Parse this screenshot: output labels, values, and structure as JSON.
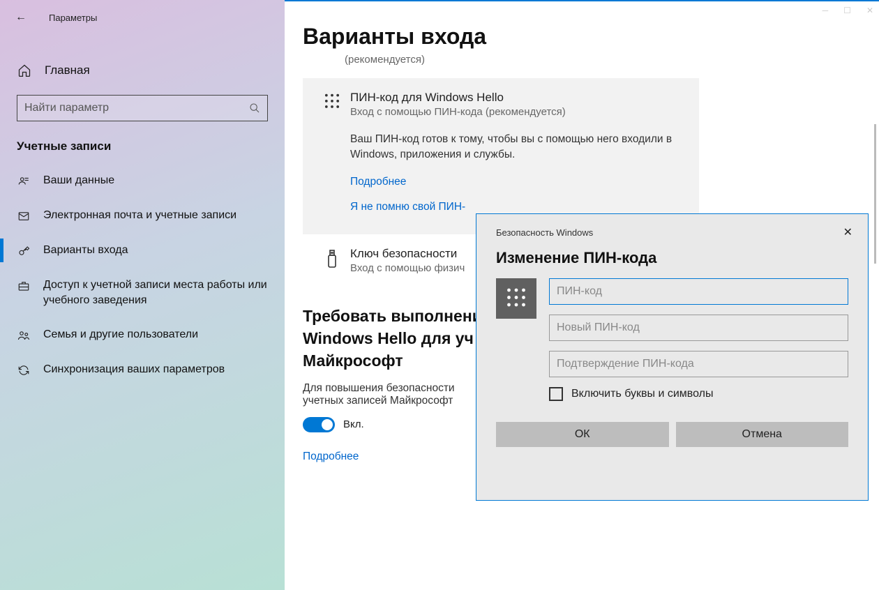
{
  "window": {
    "title": "Параметры"
  },
  "sidebar": {
    "home": "Главная",
    "search_placeholder": "Найти параметр",
    "section": "Учетные записи",
    "items": [
      "Ваши данные",
      "Электронная почта и учетные записи",
      "Варианты входа",
      "Доступ к учетной записи места работы или учебного заведения",
      "Семья и другие пользователи",
      "Синхронизация ваших параметров"
    ]
  },
  "main": {
    "title": "Варианты входа",
    "recommended": "(рекомендуется)",
    "pin": {
      "title": "ПИН-код для Windows Hello",
      "subtitle": "Вход с помощью ПИН-кода (рекомендуется)",
      "desc": "Ваш ПИН-код готов к тому, чтобы вы с помощью него входили в Windows, приложения и службы.",
      "more": "Подробнее",
      "forgot": "Я не помню свой ПИН-"
    },
    "key": {
      "title": "Ключ безопасности",
      "subtitle": "Вход с помощью физич"
    },
    "require": {
      "title": "Требовать выполнени\nWindows Hello для уч\nМайкрософт",
      "desc": "Для повышения безопасности\nучетных записей Майкрософт",
      "toggle_label": "Вкл.",
      "more": "Подробнее"
    }
  },
  "dialog": {
    "app": "Безопасность Windows",
    "title": "Изменение ПИН-кода",
    "placeholders": {
      "current": "ПИН-код",
      "new": "Новый ПИН-код",
      "confirm": "Подтверждение ПИН-кода"
    },
    "checkbox": "Включить буквы и символы",
    "ok": "ОК",
    "cancel": "Отмена"
  }
}
